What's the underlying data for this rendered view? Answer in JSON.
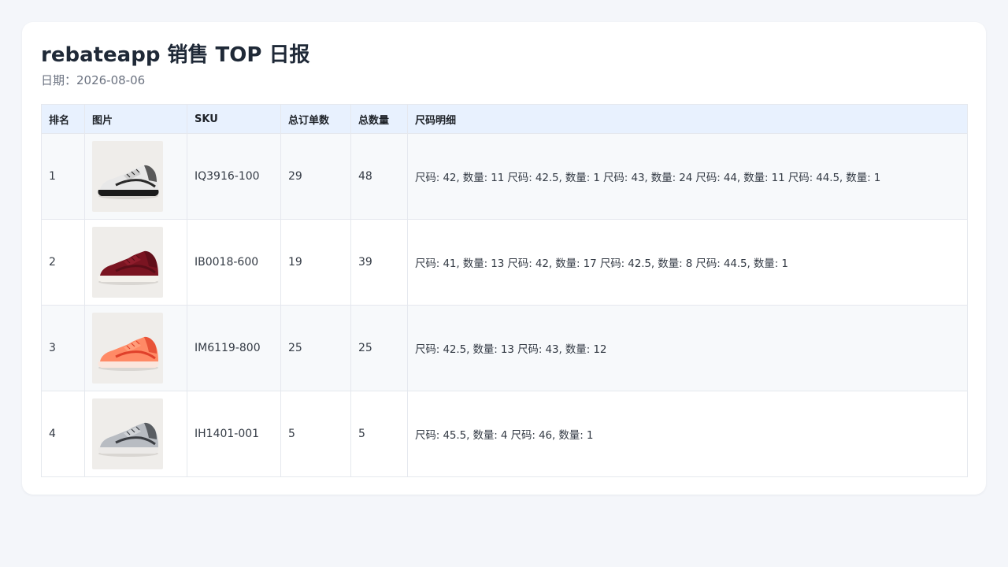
{
  "report": {
    "title": "rebateapp 销售 TOP 日报",
    "date_label": "日期：2026-08-06"
  },
  "table": {
    "headers": {
      "rank": "排名",
      "image": "图片",
      "sku": "SKU",
      "orders": "总订单数",
      "quantity": "总数量",
      "size_detail": "尺码明细"
    },
    "rows": [
      {
        "rank": "1",
        "sku": "IQ3916-100",
        "orders": "29",
        "quantity": "48",
        "size_detail": "尺码: 42, 数量: 11 尺码: 42.5, 数量: 1 尺码: 43, 数量: 24 尺码: 44, 数量: 11 尺码: 44.5, 数量: 1",
        "shoe": {
          "upper": "#e8e8e8",
          "accent": "#cfcfcf",
          "sole": "#1b1b1b",
          "dark": "#2a2a2a",
          "bg": "#efedea"
        }
      },
      {
        "rank": "2",
        "sku": "IB0018-600",
        "orders": "19",
        "quantity": "39",
        "size_detail": "尺码: 41, 数量: 13 尺码: 42, 数量: 17 尺码: 42.5, 数量: 8 尺码: 44.5, 数量: 1",
        "shoe": {
          "upper": "#7a1421",
          "accent": "#8f1d2c",
          "sole": "#f4f1ec",
          "dark": "#5a0e18",
          "bg": "#efedea"
        }
      },
      {
        "rank": "3",
        "sku": "IM6119-800",
        "orders": "25",
        "quantity": "25",
        "size_detail": "尺码: 42.5, 数量: 13 尺码: 43, 数量: 12",
        "shoe": {
          "upper": "#ff8a66",
          "accent": "#ff9d7a",
          "sole": "#fbe6dd",
          "dark": "#e0402a",
          "bg": "#efedea"
        }
      },
      {
        "rank": "4",
        "sku": "IH1401-001",
        "orders": "5",
        "quantity": "5",
        "size_detail": "尺码: 45.5, 数量: 4 尺码: 46, 数量: 1",
        "shoe": {
          "upper": "#b8bcc2",
          "accent": "#cfd2d6",
          "sole": "#eceae8",
          "dark": "#3a3d42",
          "bg": "#efedea"
        }
      }
    ]
  }
}
